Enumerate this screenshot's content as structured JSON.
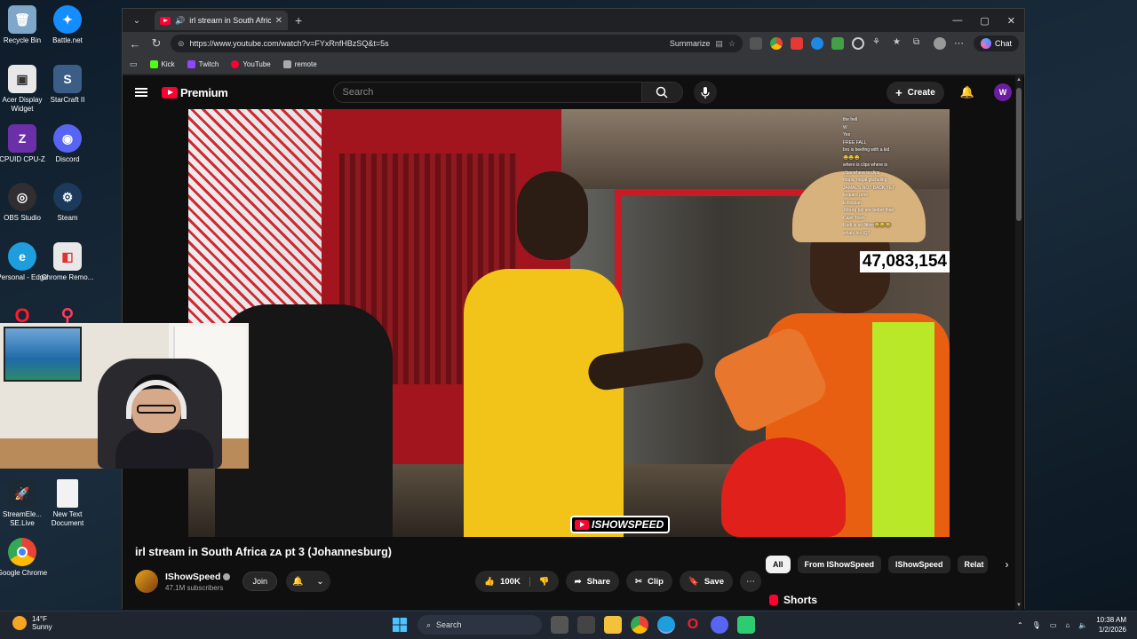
{
  "desktop": {
    "icons": [
      {
        "label": "Recycle Bin",
        "color": "#7fa7c9"
      },
      {
        "label": "Battle.net",
        "color": "#148eff"
      },
      {
        "label": "Acer Display Widget",
        "color": "#e8e8e8"
      },
      {
        "label": "StarCraft II",
        "color": "#3a5e86"
      },
      {
        "label": "CPUID CPU-Z",
        "color": "#6b2fa8"
      },
      {
        "label": "Discord",
        "color": "#5865f2"
      },
      {
        "label": "OBS Studio",
        "color": "#302e31"
      },
      {
        "label": "Steam",
        "color": "#1b3a5c"
      },
      {
        "label": "Personal - Edge",
        "color": "#1f9ede"
      },
      {
        "label": "Chrome Remo...",
        "color": "#e8e8e8"
      },
      {
        "label": "StreamEle... SE.Live",
        "color": "#1c2a36"
      },
      {
        "label": "New Text Document",
        "color": "#f2f2f2"
      },
      {
        "label": "Google Chrome",
        "color": "#ea4335"
      }
    ]
  },
  "browser": {
    "tab_title": "irl stream in South Africa ᴢᴀ pt 3",
    "url": "https://www.youtube.com/watch?v=FYxRnfHBzSQ&t=5s",
    "summarize_label": "Summarize",
    "chat_label": "Chat",
    "bookmarks": [
      {
        "label": "Kick",
        "color": "#53fc18"
      },
      {
        "label": "Twitch",
        "color": "#9146ff"
      },
      {
        "label": "YouTube",
        "color": "#ff0033"
      },
      {
        "label": "remote",
        "color": "#aaaaaa"
      }
    ]
  },
  "youtube": {
    "brand": "Premium",
    "search_placeholder": "Search",
    "create_label": "Create",
    "avatar_letter": "W",
    "video": {
      "chat_lines": [
        "the hell",
        "W",
        "Yes",
        "FREE FALL",
        "bro is beefing with a kid",
        "😂😂😂",
        "where is clips where is",
        "clips where is clips",
        "maps, nogal glizbeling",
        "JAMAL'S NOT BACK YET",
        "leopard print",
        "Ethiopian",
        "Joburg ppl are better than",
        "Capit Town",
        "Rudi is so fitline😂😂😂",
        "whats his IQ?"
      ],
      "counter": "47,083,154",
      "watermark": "ISHOWSPEED"
    },
    "title": "irl stream in South Africa ᴢᴀ pt 3 (Johannesburg)",
    "channel": {
      "name": "IShowSpeed",
      "subscribers": "47.1M subscribers",
      "join_label": "Join"
    },
    "actions": {
      "likes": "100K",
      "share": "Share",
      "clip": "Clip",
      "save": "Save"
    },
    "chips": [
      "All",
      "From IShowSpeed",
      "IShowSpeed",
      "Relat"
    ],
    "shorts_label": "Shorts"
  },
  "taskbar": {
    "temperature": "14°F",
    "condition": "Sunny",
    "search_label": "Search",
    "time": "10:38 AM",
    "date": "1/2/2026"
  }
}
